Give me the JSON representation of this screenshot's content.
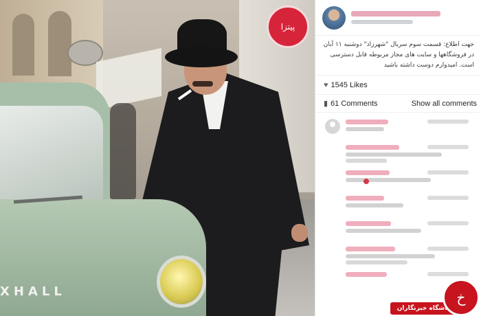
{
  "photo": {
    "shop_sign_text": "پیتزا",
    "car_badge": "XHALL"
  },
  "post": {
    "caption": "جهت اطلاع: قسمت سوم سریال \"شهرزاد\" دوشنبه ۱۱ آبان در فروشگاهها و سایت های مجاز مربوطه قابل دسترسی است. امیدوارم دوست داشته باشید",
    "likes": "1545 Likes",
    "comments_count": "61 Comments",
    "show_all": "Show all comments"
  },
  "icons": {
    "like": "heart-icon",
    "comment": "comment-bubble-icon",
    "user": "default-user-icon"
  },
  "watermark": {
    "label": "باشگاه خبرنگاران",
    "logo_glyph": "خ"
  },
  "colors": {
    "brand_red": "#c7141e",
    "username_pink": "#ec9aad"
  }
}
